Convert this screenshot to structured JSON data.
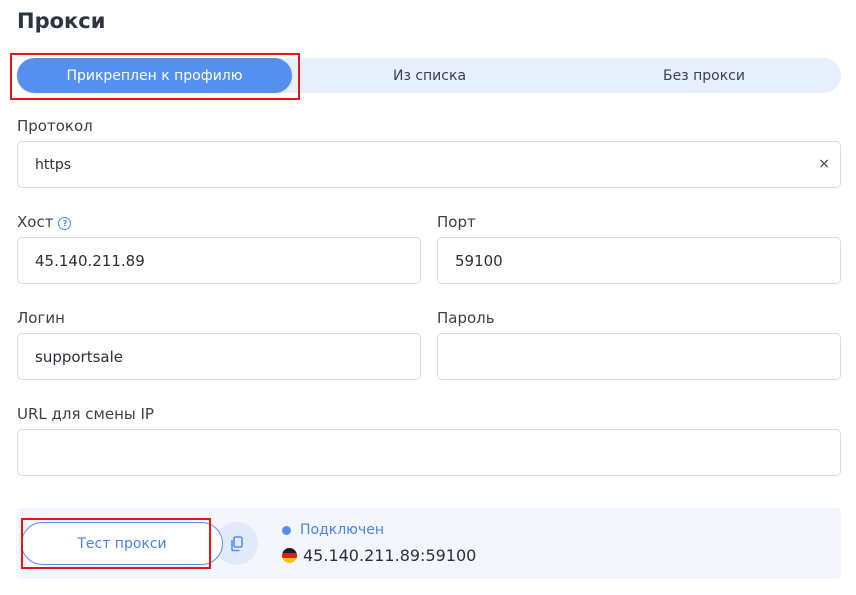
{
  "page": {
    "title": "Прокси"
  },
  "tabs": [
    {
      "label": "Прикреплен к профилю",
      "active": true
    },
    {
      "label": "Из списка",
      "active": false
    },
    {
      "label": "Без прокси",
      "active": false
    }
  ],
  "form": {
    "protocol": {
      "label": "Протокол",
      "value": "https"
    },
    "host": {
      "label": "Хост",
      "value": "45.140.211.89"
    },
    "port": {
      "label": "Порт",
      "value": "59100"
    },
    "login": {
      "label": "Логин",
      "value": "supportsale"
    },
    "password": {
      "label": "Пароль",
      "value": ""
    },
    "change_ip_url": {
      "label": "URL для смены IP",
      "value": ""
    }
  },
  "status": {
    "test_button": "Тест прокси",
    "state": "Подключен",
    "address": "45.140.211.89:59100",
    "country_flag": "germany-flag-icon"
  },
  "colors": {
    "accent": "#5590ef",
    "highlight": "#e3161b"
  }
}
